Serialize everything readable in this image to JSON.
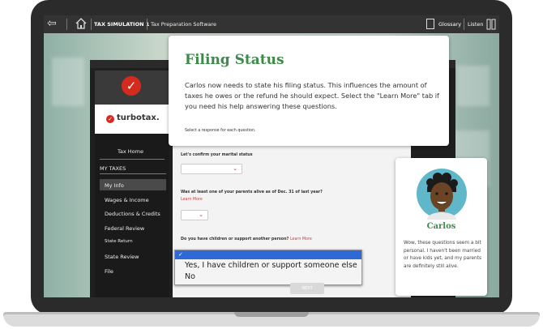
{
  "topbar": {
    "title": "TAX SIMULATION 1",
    "subtitle": "Tax Preparation Software",
    "glossary": "Glossary",
    "listen": "Listen"
  },
  "icons": {
    "back": "back-arrow-icon",
    "home": "home-icon",
    "glossary": "book-icon",
    "listen": "headphones-icon",
    "check": "checkmark-icon",
    "chevron": "chevron-down-icon"
  },
  "sidebar": {
    "brand": "turbotax.",
    "tax_home": "Tax Home",
    "section": "MY TAXES",
    "items": [
      {
        "label": "My Info",
        "active": true
      },
      {
        "label": "Wages & Income"
      },
      {
        "label": "Deductions & Credits"
      },
      {
        "label": "Federal Review"
      },
      {
        "label": "State Return"
      },
      {
        "label": "State Review"
      },
      {
        "label": "File"
      }
    ]
  },
  "card": {
    "title": "Filing Status",
    "body": "Carlos now needs to state his filing status. This influences the amount of taxes he owes or the refund he should expect. Select the \"Learn More\" tab if you need his help answering these questions.",
    "note": "Select a response for each question."
  },
  "form": {
    "q1": "Let's confirm your marital status",
    "q2": "Was at least one of your parents alive as of Dec. 31 of last year?",
    "q2_link": "Learn More",
    "q3": "Do you have children or support another person?",
    "q3_link": "Learn More",
    "dropdown": {
      "selected_mark": "✓",
      "options": [
        "Yes, I have children or support someone else",
        "No"
      ]
    },
    "next_label": "NEXT"
  },
  "carlos": {
    "name": "Carlos",
    "text": "Wow, these questions seem a bit personal. I haven't been married or have kids yet, and my parents are definitely still alive."
  },
  "colors": {
    "accent_green": "#3e8a4b",
    "turbotax_red": "#d52b1e",
    "select_blue": "#2f69d6"
  }
}
